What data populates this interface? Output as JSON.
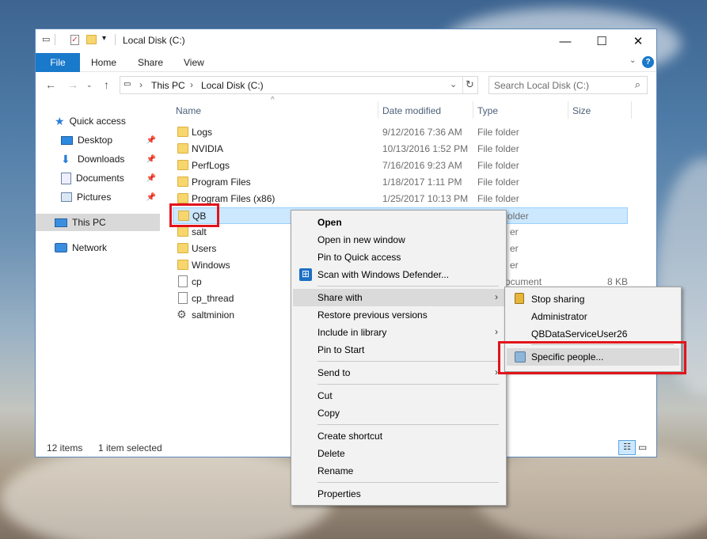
{
  "window": {
    "title": "Local Disk (C:)",
    "controls": {
      "minimize": "—",
      "maximize": "☐",
      "close": "✕"
    }
  },
  "ribbon": {
    "tabs": [
      "File",
      "Home",
      "Share",
      "View"
    ]
  },
  "address": {
    "breadcrumb": [
      "This PC",
      "Local Disk (C:)"
    ],
    "search_placeholder": "Search Local Disk (C:)"
  },
  "nav": {
    "quick_access": "Quick access",
    "pinned": [
      "Desktop",
      "Downloads",
      "Documents",
      "Pictures"
    ],
    "this_pc": "This PC",
    "network": "Network"
  },
  "columns": {
    "name": "Name",
    "date": "Date modified",
    "type": "Type",
    "size": "Size"
  },
  "files": [
    {
      "name": "Logs",
      "date": "9/12/2016 7:36 AM",
      "type": "File folder",
      "size": "",
      "kind": "folder"
    },
    {
      "name": "NVIDIA",
      "date": "10/13/2016 1:52 PM",
      "type": "File folder",
      "size": "",
      "kind": "folder"
    },
    {
      "name": "PerfLogs",
      "date": "7/16/2016 9:23 AM",
      "type": "File folder",
      "size": "",
      "kind": "folder"
    },
    {
      "name": "Program Files",
      "date": "1/18/2017 1:11 PM",
      "type": "File folder",
      "size": "",
      "kind": "folder"
    },
    {
      "name": "Program Files (x86)",
      "date": "1/25/2017 10:13 PM",
      "type": "File folder",
      "size": "",
      "kind": "folder"
    },
    {
      "name": "QB",
      "date": "",
      "type": "older",
      "size": "",
      "kind": "folder"
    },
    {
      "name": "salt",
      "date": "",
      "type": "er",
      "size": "",
      "kind": "folder"
    },
    {
      "name": "Users",
      "date": "",
      "type": "er",
      "size": "",
      "kind": "folder"
    },
    {
      "name": "Windows",
      "date": "",
      "type": "er",
      "size": "",
      "kind": "folder"
    },
    {
      "name": "cp",
      "date": "",
      "type": "ocument",
      "size": "8 KB",
      "kind": "file"
    },
    {
      "name": "cp_thread",
      "date": "",
      "type": "",
      "size": "",
      "kind": "file"
    },
    {
      "name": "saltminion",
      "date": "",
      "type": "",
      "size": "",
      "kind": "gear"
    }
  ],
  "status": {
    "count": "12 items",
    "selected": "1 item selected"
  },
  "context_menu": {
    "items": [
      "Open",
      "Open in new window",
      "Pin to Quick access",
      "Scan with Windows Defender...",
      "Share with",
      "Restore previous versions",
      "Include in library",
      "Pin to Start",
      "Send to",
      "Cut",
      "Copy",
      "Create shortcut",
      "Delete",
      "Rename",
      "Properties"
    ]
  },
  "share_menu": {
    "items": [
      "Stop sharing",
      "Administrator",
      "QBDataServiceUser26",
      "Specific people..."
    ]
  },
  "colors": {
    "accent": "#1979ca",
    "selection": "#cce8ff",
    "highlight_box": "#e1141b"
  }
}
